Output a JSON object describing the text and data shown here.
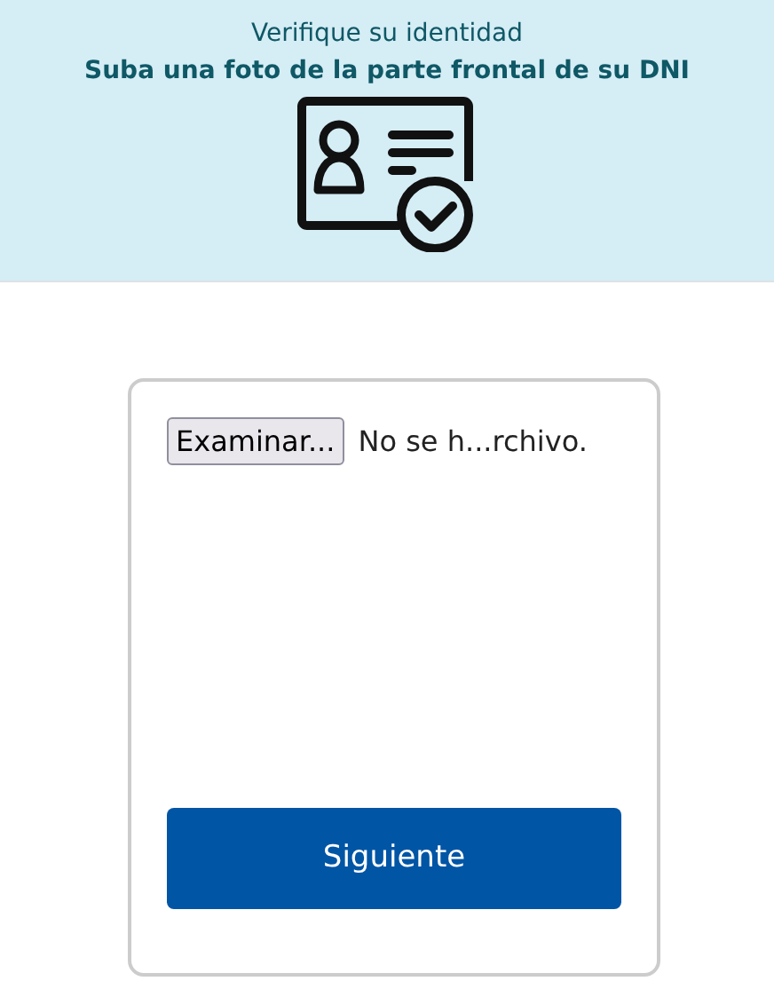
{
  "header": {
    "title": "Verifique su identidad",
    "subtitle": "Suba una foto de la parte frontal de su DNI"
  },
  "file_input": {
    "button": "Examinar...",
    "status": "No se h...rchivo."
  },
  "buttons": [
    "Siguiente"
  ]
}
